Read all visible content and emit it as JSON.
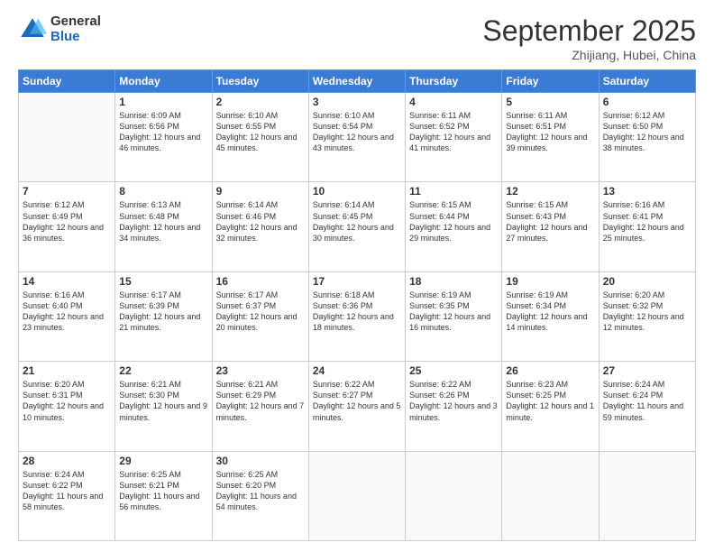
{
  "logo": {
    "general": "General",
    "blue": "Blue"
  },
  "title": "September 2025",
  "location": "Zhijiang, Hubei, China",
  "days_of_week": [
    "Sunday",
    "Monday",
    "Tuesday",
    "Wednesday",
    "Thursday",
    "Friday",
    "Saturday"
  ],
  "weeks": [
    [
      {
        "day": "",
        "info": ""
      },
      {
        "day": "1",
        "info": "Sunrise: 6:09 AM\nSunset: 6:56 PM\nDaylight: 12 hours\nand 46 minutes."
      },
      {
        "day": "2",
        "info": "Sunrise: 6:10 AM\nSunset: 6:55 PM\nDaylight: 12 hours\nand 45 minutes."
      },
      {
        "day": "3",
        "info": "Sunrise: 6:10 AM\nSunset: 6:54 PM\nDaylight: 12 hours\nand 43 minutes."
      },
      {
        "day": "4",
        "info": "Sunrise: 6:11 AM\nSunset: 6:52 PM\nDaylight: 12 hours\nand 41 minutes."
      },
      {
        "day": "5",
        "info": "Sunrise: 6:11 AM\nSunset: 6:51 PM\nDaylight: 12 hours\nand 39 minutes."
      },
      {
        "day": "6",
        "info": "Sunrise: 6:12 AM\nSunset: 6:50 PM\nDaylight: 12 hours\nand 38 minutes."
      }
    ],
    [
      {
        "day": "7",
        "info": "Sunrise: 6:12 AM\nSunset: 6:49 PM\nDaylight: 12 hours\nand 36 minutes."
      },
      {
        "day": "8",
        "info": "Sunrise: 6:13 AM\nSunset: 6:48 PM\nDaylight: 12 hours\nand 34 minutes."
      },
      {
        "day": "9",
        "info": "Sunrise: 6:14 AM\nSunset: 6:46 PM\nDaylight: 12 hours\nand 32 minutes."
      },
      {
        "day": "10",
        "info": "Sunrise: 6:14 AM\nSunset: 6:45 PM\nDaylight: 12 hours\nand 30 minutes."
      },
      {
        "day": "11",
        "info": "Sunrise: 6:15 AM\nSunset: 6:44 PM\nDaylight: 12 hours\nand 29 minutes."
      },
      {
        "day": "12",
        "info": "Sunrise: 6:15 AM\nSunset: 6:43 PM\nDaylight: 12 hours\nand 27 minutes."
      },
      {
        "day": "13",
        "info": "Sunrise: 6:16 AM\nSunset: 6:41 PM\nDaylight: 12 hours\nand 25 minutes."
      }
    ],
    [
      {
        "day": "14",
        "info": "Sunrise: 6:16 AM\nSunset: 6:40 PM\nDaylight: 12 hours\nand 23 minutes."
      },
      {
        "day": "15",
        "info": "Sunrise: 6:17 AM\nSunset: 6:39 PM\nDaylight: 12 hours\nand 21 minutes."
      },
      {
        "day": "16",
        "info": "Sunrise: 6:17 AM\nSunset: 6:37 PM\nDaylight: 12 hours\nand 20 minutes."
      },
      {
        "day": "17",
        "info": "Sunrise: 6:18 AM\nSunset: 6:36 PM\nDaylight: 12 hours\nand 18 minutes."
      },
      {
        "day": "18",
        "info": "Sunrise: 6:19 AM\nSunset: 6:35 PM\nDaylight: 12 hours\nand 16 minutes."
      },
      {
        "day": "19",
        "info": "Sunrise: 6:19 AM\nSunset: 6:34 PM\nDaylight: 12 hours\nand 14 minutes."
      },
      {
        "day": "20",
        "info": "Sunrise: 6:20 AM\nSunset: 6:32 PM\nDaylight: 12 hours\nand 12 minutes."
      }
    ],
    [
      {
        "day": "21",
        "info": "Sunrise: 6:20 AM\nSunset: 6:31 PM\nDaylight: 12 hours\nand 10 minutes."
      },
      {
        "day": "22",
        "info": "Sunrise: 6:21 AM\nSunset: 6:30 PM\nDaylight: 12 hours\nand 9 minutes."
      },
      {
        "day": "23",
        "info": "Sunrise: 6:21 AM\nSunset: 6:29 PM\nDaylight: 12 hours\nand 7 minutes."
      },
      {
        "day": "24",
        "info": "Sunrise: 6:22 AM\nSunset: 6:27 PM\nDaylight: 12 hours\nand 5 minutes."
      },
      {
        "day": "25",
        "info": "Sunrise: 6:22 AM\nSunset: 6:26 PM\nDaylight: 12 hours\nand 3 minutes."
      },
      {
        "day": "26",
        "info": "Sunrise: 6:23 AM\nSunset: 6:25 PM\nDaylight: 12 hours\nand 1 minute."
      },
      {
        "day": "27",
        "info": "Sunrise: 6:24 AM\nSunset: 6:24 PM\nDaylight: 11 hours\nand 59 minutes."
      }
    ],
    [
      {
        "day": "28",
        "info": "Sunrise: 6:24 AM\nSunset: 6:22 PM\nDaylight: 11 hours\nand 58 minutes."
      },
      {
        "day": "29",
        "info": "Sunrise: 6:25 AM\nSunset: 6:21 PM\nDaylight: 11 hours\nand 56 minutes."
      },
      {
        "day": "30",
        "info": "Sunrise: 6:25 AM\nSunset: 6:20 PM\nDaylight: 11 hours\nand 54 minutes."
      },
      {
        "day": "",
        "info": ""
      },
      {
        "day": "",
        "info": ""
      },
      {
        "day": "",
        "info": ""
      },
      {
        "day": "",
        "info": ""
      }
    ]
  ]
}
